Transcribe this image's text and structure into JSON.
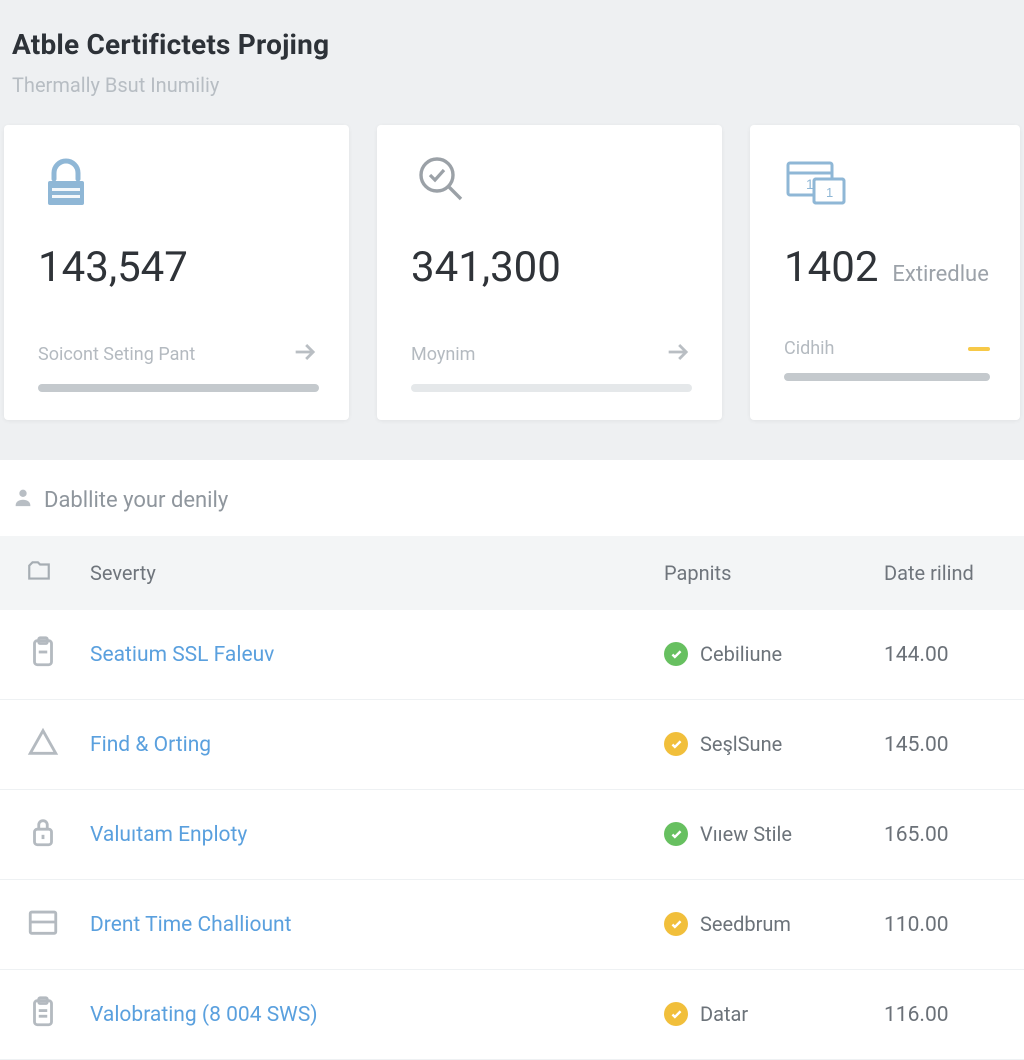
{
  "header": {
    "title": "Atble Certifictets Projing",
    "subtitle": "Thermally Bsut Inumiliy"
  },
  "cards": [
    {
      "icon": "lock-icon",
      "value": "143,547",
      "suffix": "",
      "footer_label": "Soicont Seting Pant",
      "footer_action": "arrow",
      "bar_style": "solid"
    },
    {
      "icon": "magnify-check-icon",
      "value": "341,300",
      "suffix": "",
      "footer_label": "Moynim",
      "footer_action": "arrow",
      "bar_style": "light"
    },
    {
      "icon": "windows-icon",
      "value": "1402",
      "suffix": "Extiredlue",
      "footer_label": "Cidhih",
      "footer_action": "yellow-dash",
      "bar_style": "solid"
    }
  ],
  "table": {
    "title": "Dabllite your denily",
    "columns": {
      "icon": "",
      "severity": "Severty",
      "papnits": "Papnits",
      "date": "Date rilind"
    },
    "rows": [
      {
        "row_icon": "badge-icon",
        "severity": "Seatium SSL Faleuv",
        "status_color": "green",
        "papnits": "Cebiliune",
        "date": "144.00"
      },
      {
        "row_icon": "triangle-icon",
        "severity": "Find & Orting",
        "status_color": "yellow",
        "papnits": "SeşlSune",
        "date": "145.00"
      },
      {
        "row_icon": "lock2-icon",
        "severity": "Valuıtam Enploty",
        "status_color": "green",
        "papnits": "Vııew Stile",
        "date": "165.00"
      },
      {
        "row_icon": "window-icon",
        "severity": "Drent Time Challiount",
        "status_color": "yellow",
        "papnits": "Seedbrum",
        "date": "110.00"
      },
      {
        "row_icon": "clipboard-icon",
        "severity": "Valobrating (8 004 SWS)",
        "status_color": "yellow",
        "papnits": "Datar",
        "date": "116.00"
      }
    ]
  }
}
